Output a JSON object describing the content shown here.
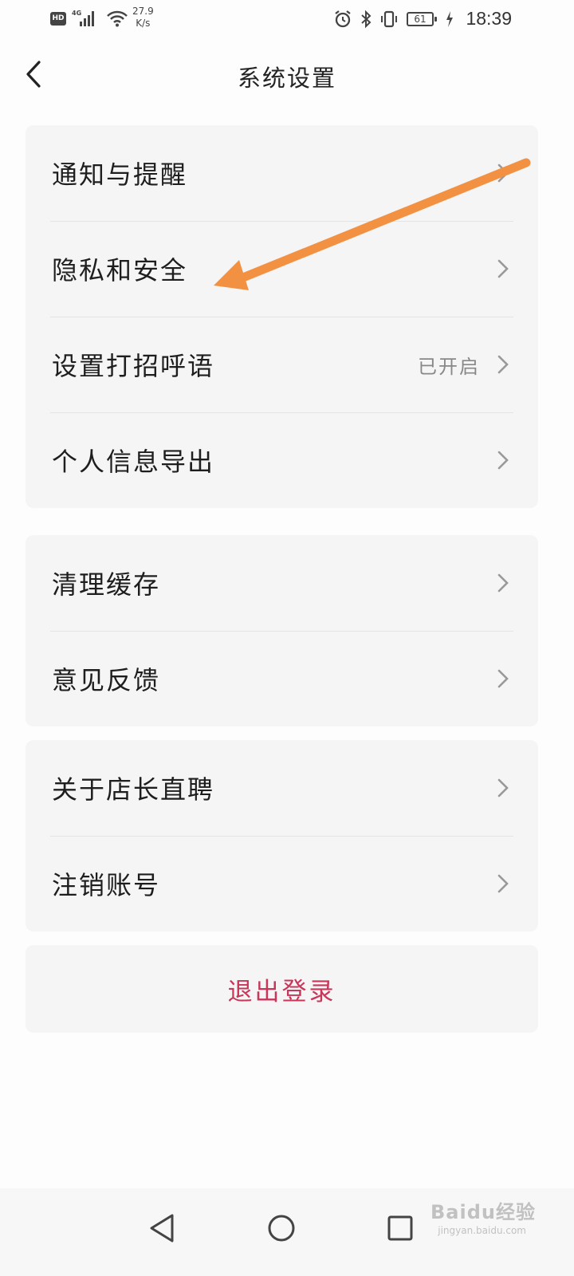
{
  "status_bar": {
    "hd": "HD",
    "network": "4G",
    "speed_value": "27.9",
    "speed_unit": "K/s",
    "battery": "61",
    "time": "18:39"
  },
  "header": {
    "title": "系统设置",
    "back_icon": "chevron-left-icon"
  },
  "groups": [
    {
      "items": [
        {
          "label": "通知与提醒",
          "value": ""
        },
        {
          "label": "隐私和安全",
          "value": ""
        },
        {
          "label": "设置打招呼语",
          "value": "已开启"
        },
        {
          "label": "个人信息导出",
          "value": ""
        }
      ]
    },
    {
      "items": [
        {
          "label": "清理缓存",
          "value": ""
        },
        {
          "label": "意见反馈",
          "value": ""
        }
      ]
    },
    {
      "items": [
        {
          "label": "关于店长直聘",
          "value": ""
        },
        {
          "label": "注销账号",
          "value": ""
        }
      ]
    }
  ],
  "logout": {
    "label": "退出登录",
    "color": "#c8365a"
  },
  "nav_bar": {
    "back_icon": "triangle-back-icon",
    "home_icon": "circle-home-icon",
    "recents_icon": "square-recents-icon"
  },
  "watermark": {
    "text": "Baidu经验",
    "sub": "jingyan.baidu.com"
  },
  "annotation": {
    "arrow_color": "#f39143"
  }
}
